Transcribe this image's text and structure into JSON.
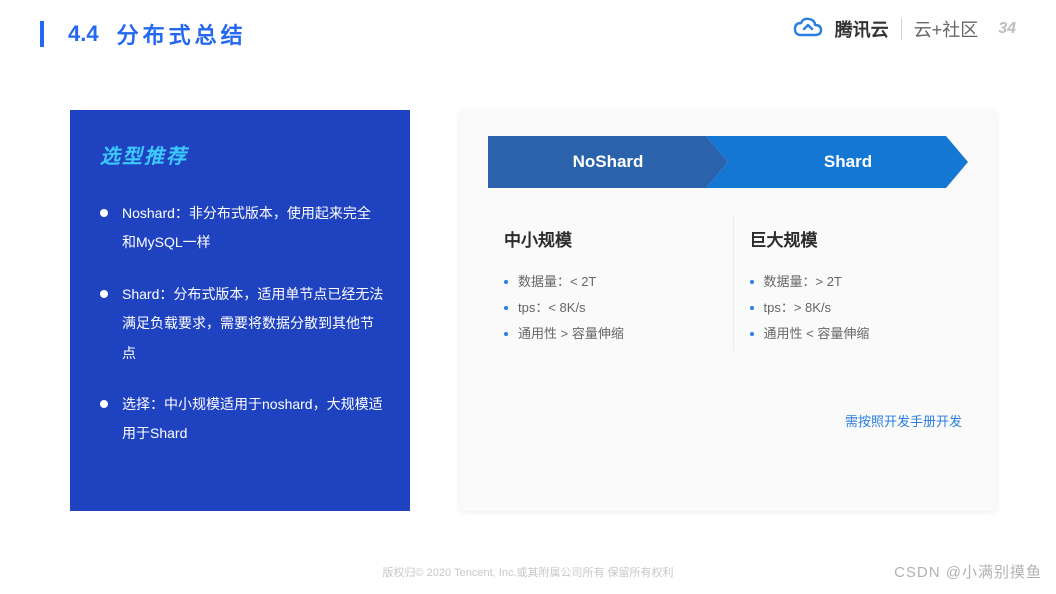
{
  "header": {
    "section_number": "4.4",
    "section_title": "分布式总结",
    "brand_cloud": "腾讯云",
    "brand_community": "云+社区",
    "page_number": "34"
  },
  "left": {
    "title": "选型推荐",
    "items": [
      "Noshard：非分布式版本，使用起来完全和MySQL一样",
      "Shard：分布式版本，适用单节点已经无法满足负载要求，需要将数据分散到其他节点",
      "选择：中小规模适用于noshard，大规模适用于Shard"
    ]
  },
  "right": {
    "arrow": {
      "noshard_label": "NoShard",
      "shard_label": "Shard"
    },
    "columns": [
      {
        "title": "中小规模",
        "items": [
          "数据量：< 2T",
          "tps：< 8K/s",
          "通用性 > 容量伸缩"
        ]
      },
      {
        "title": "巨大规模",
        "items": [
          "数据量：> 2T",
          "tps：> 8K/s",
          "通用性 < 容量伸缩"
        ]
      }
    ],
    "note": "需按照开发手册开发"
  },
  "footer": {
    "copyright": "版权归© 2020 Tencent, Inc.或其附属公司所有 保留所有权利",
    "watermark": "CSDN @小满别摸鱼"
  },
  "icons": {
    "cloud": "cloud-icon"
  }
}
